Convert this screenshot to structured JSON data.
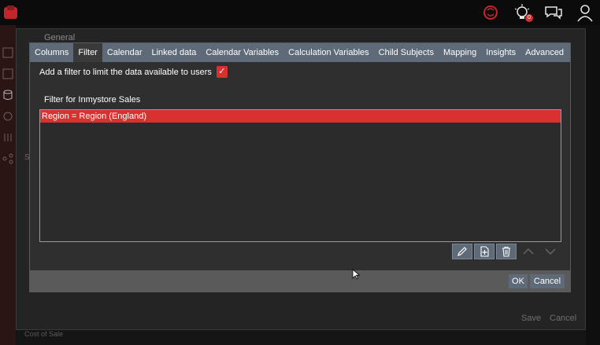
{
  "background": {
    "general_label": "General",
    "side_fragment": "S",
    "save_label": "Save",
    "cancel_label": "Cancel",
    "cost_label": "Cost of Sale",
    "notification_count": "0"
  },
  "dialog": {
    "tabs": [
      {
        "label": "Columns",
        "active": false
      },
      {
        "label": "Filter",
        "active": true
      },
      {
        "label": "Calendar",
        "active": false
      },
      {
        "label": "Linked data",
        "active": false
      },
      {
        "label": "Calendar Variables",
        "active": false
      },
      {
        "label": "Calculation Variables",
        "active": false
      },
      {
        "label": "Child Subjects",
        "active": false
      },
      {
        "label": "Mapping",
        "active": false
      },
      {
        "label": "Insights",
        "active": false
      },
      {
        "label": "Advanced",
        "active": false
      }
    ],
    "add_filter_label": "Add a filter to limit the data available to users",
    "add_filter_checked": true,
    "filter_for_label": "Filter for Inmystore Sales",
    "filters": [
      {
        "text": "Region = Region (England)",
        "selected": true
      }
    ],
    "ok_label": "OK",
    "cancel_label": "Cancel"
  },
  "icons": {
    "edit": "pencil-icon",
    "add": "add-document-icon",
    "delete": "trash-icon",
    "up": "chevron-up-icon",
    "down": "chevron-down-icon"
  },
  "colors": {
    "accent": "#d93030",
    "tab_bar": "#5e6a78",
    "dialog_bg": "#2f2f2f"
  }
}
